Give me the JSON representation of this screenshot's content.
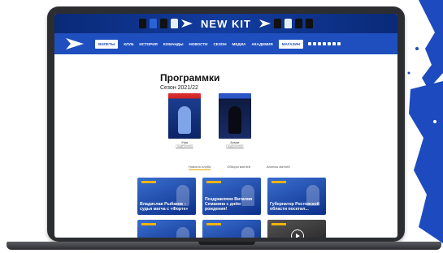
{
  "banner": {
    "title": "NEW KIT",
    "shirt_colors": [
      "#111",
      "#111",
      "#111",
      "#2a63d6",
      "#111",
      "#1f4fbf",
      "#111",
      "#111"
    ]
  },
  "nav": {
    "items": [
      "ВИЛЕТЫ",
      "КЛУБ",
      "ИСТОРИЯ",
      "КОМАНДЫ",
      "НОВОСТИ",
      "СЕЗОН",
      "МЕДИА",
      "АКАДЕМИЯ"
    ],
    "shop": "МАГАЗИН"
  },
  "page": {
    "title": "Программки",
    "season": "Сезон 2021/22"
  },
  "programs": [
    {
      "caption": "Уфа",
      "sub": "ПОДРОБНЕЕ"
    },
    {
      "caption": "Ахмат",
      "sub": "ПОДРОБНЕЕ"
    }
  ],
  "tabs": [
    "Новости клуба",
    "Обзоры матчей",
    "Анонсы матчей"
  ],
  "news": [
    {
      "text": "Владислав Рыбаков – судья матча с «Фортe»"
    },
    {
      "text": "Поздравляем Виталия Семакина с днём рождения!"
    },
    {
      "text": "Губернатор Ростовской области посетил..."
    },
    {
      "text": ""
    },
    {
      "text": ""
    },
    {
      "text": ""
    }
  ],
  "colors": {
    "accent": "#1f4fbf",
    "dark_blue": "#0a2a78",
    "gold": "#e8a200"
  }
}
